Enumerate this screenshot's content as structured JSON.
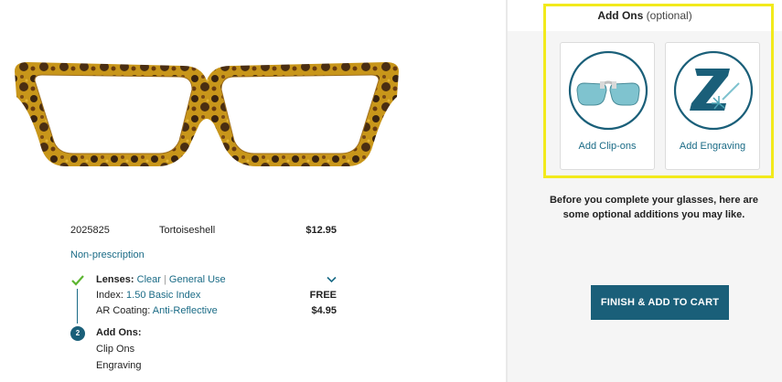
{
  "product": {
    "sku": "2025825",
    "color_name": "Tortoiseshell",
    "price": "$12.95",
    "prescription_type": "Non-prescription"
  },
  "options": {
    "lenses_label": "Lenses:",
    "lenses_value": "Clear",
    "lenses_separator": "|",
    "lenses_use": "General Use",
    "index_label": "Index:",
    "index_value": "1.50 Basic Index",
    "index_price": "FREE",
    "ar_label": "AR Coating:",
    "ar_value": "Anti-Reflective",
    "ar_price": "$4.95",
    "step_number": "2",
    "addons_label": "Add Ons:",
    "addon_items": [
      "Clip Ons",
      "Engraving"
    ]
  },
  "addons_panel": {
    "title": "Add Ons",
    "title_note": "(optional)",
    "cards": [
      {
        "label": "Add Clip-ons",
        "icon": "clip-on-sunglasses-icon"
      },
      {
        "label": "Add Engraving",
        "icon": "engraving-z-icon"
      }
    ],
    "blurb_line1": "Before you complete your glasses, here are",
    "blurb_line2": "some optional additions you may like.",
    "finish_button": "FINISH & ADD TO CART"
  },
  "colors": {
    "accent": "#1a6b86",
    "button": "#1a5f79",
    "highlight": "#f2ea1b",
    "check": "#5cb531"
  }
}
